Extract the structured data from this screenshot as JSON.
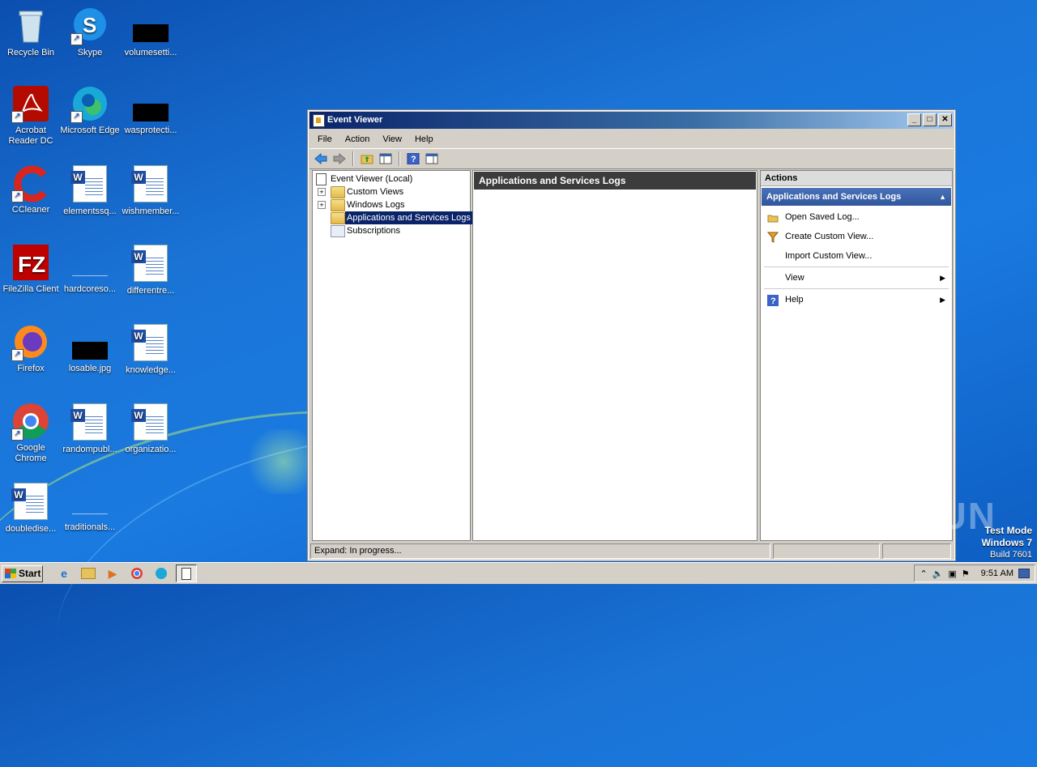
{
  "desktop": {
    "icons": [
      {
        "label": "Recycle Bin"
      },
      {
        "label": "Skype"
      },
      {
        "label": "volumesetti..."
      },
      {
        "label": "Acrobat Reader DC"
      },
      {
        "label": "Microsoft Edge"
      },
      {
        "label": "wasprotecti..."
      },
      {
        "label": "CCleaner"
      },
      {
        "label": "elementssq..."
      },
      {
        "label": "wishmember..."
      },
      {
        "label": "FileZilla Client"
      },
      {
        "label": "hardcoreso..."
      },
      {
        "label": "differentre..."
      },
      {
        "label": "Firefox"
      },
      {
        "label": "losable.jpg"
      },
      {
        "label": "knowledge..."
      },
      {
        "label": "Google Chrome"
      },
      {
        "label": "randompubl..."
      },
      {
        "label": "organizatio..."
      },
      {
        "label": "doubledise..."
      },
      {
        "label": "traditionals..."
      }
    ]
  },
  "window": {
    "title": "Event Viewer",
    "menu": [
      "File",
      "Action",
      "View",
      "Help"
    ],
    "tree": {
      "root": "Event Viewer (Local)",
      "items": [
        "Custom Views",
        "Windows Logs",
        "Applications and Services Logs",
        "Subscriptions"
      ]
    },
    "middle_title": "Applications and Services Logs",
    "actions": {
      "header": "Actions",
      "section": "Applications and Services Logs",
      "items": [
        "Open Saved Log...",
        "Create Custom View...",
        "Import Custom View...",
        "View",
        "Help"
      ]
    },
    "status": "Expand:  In progress..."
  },
  "taskbar": {
    "start": "Start",
    "clock": "9:51 AM"
  },
  "watermark": {
    "brand": "ANY RUN",
    "line1": "Test Mode",
    "line2": "Windows 7",
    "line3": "Build 7601"
  },
  "colors": {
    "selection": "#0a246a",
    "actions_section": "#3a62a8",
    "title_gradient_start": "#0a246a"
  }
}
